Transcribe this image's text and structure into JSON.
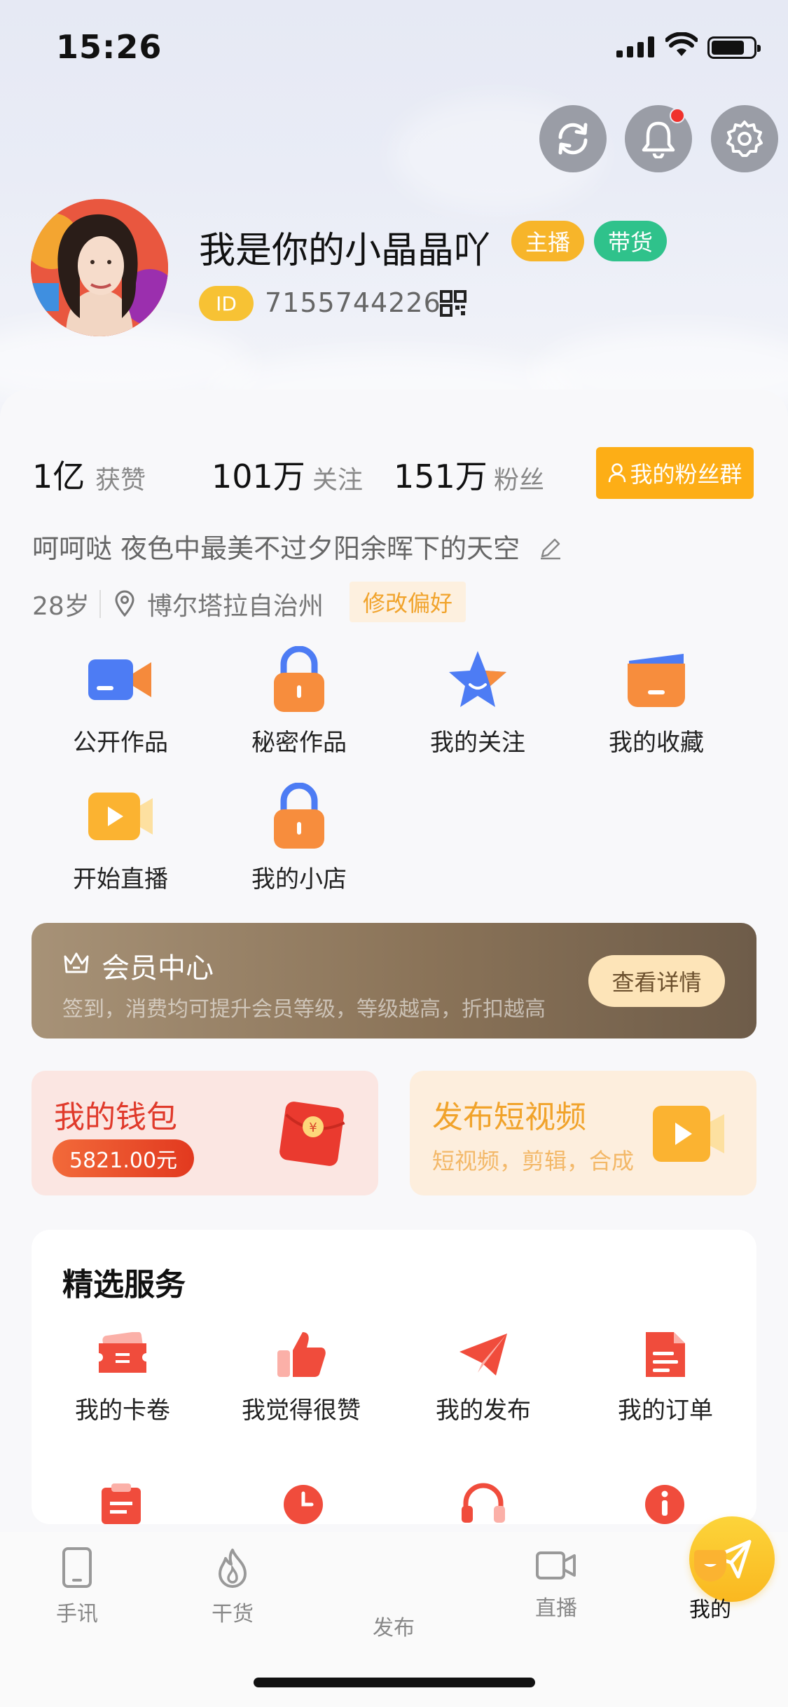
{
  "status": {
    "time": "15:26"
  },
  "profile": {
    "name": "我是你的小晶晶吖",
    "badges": [
      "主播",
      "带货"
    ],
    "id_label": "ID",
    "id_value": "7155744226"
  },
  "stats": [
    {
      "value": "1亿",
      "label": "获赞"
    },
    {
      "value": "101万",
      "label": "关注"
    },
    {
      "value": "151万",
      "label": "粉丝"
    }
  ],
  "fans_group_label": "我的粉丝群",
  "bio": "呵呵哒 夜色中最美不过夕阳余晖下的天空",
  "age": "28岁",
  "location": "博尔塔拉自治州",
  "edit_pref_label": "修改偏好",
  "grid": [
    {
      "label": "公开作品",
      "icon": "video-camera-icon"
    },
    {
      "label": "秘密作品",
      "icon": "lock-icon"
    },
    {
      "label": "我的关注",
      "icon": "star-icon"
    },
    {
      "label": "我的收藏",
      "icon": "folder-icon"
    },
    {
      "label": "开始直播",
      "icon": "live-camera-icon"
    },
    {
      "label": "我的小店",
      "icon": "shop-lock-icon"
    }
  ],
  "member": {
    "title": "会员中心",
    "subtitle": "签到，消费均可提升会员等级，等级越高，折扣越高",
    "button": "查看详情"
  },
  "wallet": {
    "title": "我的钱包",
    "amount": "5821.00元"
  },
  "publish": {
    "title": "发布短视频",
    "subtitle": "短视频，剪辑，合成"
  },
  "services": {
    "title": "精选服务",
    "items": [
      {
        "label": "我的卡卷",
        "icon": "ticket-icon"
      },
      {
        "label": "我觉得很赞",
        "icon": "thumbs-up-icon"
      },
      {
        "label": "我的发布",
        "icon": "paper-plane-icon"
      },
      {
        "label": "我的订单",
        "icon": "document-icon"
      }
    ]
  },
  "tabbar": [
    {
      "label": "手讯",
      "icon": "phone-icon"
    },
    {
      "label": "干货",
      "icon": "fire-icon"
    },
    {
      "label": "发布",
      "icon": "send-icon"
    },
    {
      "label": "直播",
      "icon": "video-icon"
    },
    {
      "label": "我的",
      "icon": "me-icon"
    }
  ],
  "colors": {
    "accent_orange": "#fdae16",
    "badge_anchor": "#f7b52a",
    "badge_goods": "#2fc28b",
    "wallet_red": "#e03a2b",
    "publish_orange": "#f1a32b"
  }
}
